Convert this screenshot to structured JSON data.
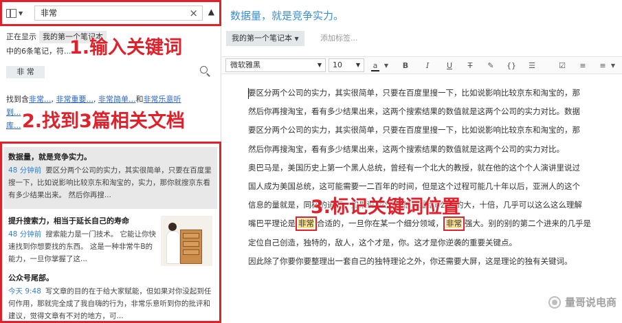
{
  "search": {
    "query": "非常",
    "clear_icon": "×",
    "collapse_icon": "▲"
  },
  "scope": {
    "prefix": "正在显示",
    "notebook": "我的第一个笔记本",
    "count_text": "中的6条笔记，符..."
  },
  "keyword_chip": "非 常",
  "found": {
    "prefix": "找到含",
    "links": [
      "非常...",
      "非常重要...",
      "非常简单...",
      "非常乐意听",
      "到...",
      "库..."
    ],
    "joiners": [
      ", ",
      ", ",
      "和"
    ]
  },
  "annotations": {
    "step1": "1.输入关键词",
    "step2": "2.找到3篇相关文档",
    "step3": "3.标记关键词位置"
  },
  "results": [
    {
      "title": "数据量，就是竞争实力。",
      "time": "48 分钟前",
      "snippet": "要区分两个公司的实力，其实很简单，只要在百度里搜一下，比如说影响比较京东和淘宝的，实力，那你就搜京东看有多少结果出来。 然后你再搜..."
    },
    {
      "title": "提升搜索力，相当于延长自己的寿命",
      "time": "48 分钟前",
      "snippet": "搜索能力是一门技术。 它能让你快速找到你想要找的东西。 这是一种非常牛B的能力，一旦你掌握了这..."
    },
    {
      "title": "公众号尾部。",
      "time": "今天 9:48",
      "snippet": "写文章的目的在于给大家赋能，但如果对你没起到任何作用，那就完全成了我自嗨的行为，非常乐意听到你的批评和建议，觉得文章有不对的地方，可..."
    }
  ],
  "note": {
    "title": "数据量，就是竞争实力。",
    "notebook_button": "我的第一个笔记本",
    "add_tag_placeholder": "添加标签...",
    "font": "微软雅黑",
    "size": "10",
    "paragraphs": [
      "要区分两个公司的实力，其实很简单，只要在百度里搜一下，比如说影响比较京东和淘宝的，那",
      "然后你再搜淘宝，看有多少结果出来，这两个搜索结果的数值就是这两个公司的实力对比。数据",
      "要区分两个公司的实力，其实很简单，只要在百度里搜一下，比如说影响比较京东和淘宝的，那",
      "然后你再搜淘宝，看有多少结果出来，这两个搜索结果的数值就是这两个公司的实力对比。",
      "奥巴马是，美国历史上第一个黑人总统，曾经有一个北大的教授，就在他的这个个人演讲里说过",
      "国人成为美国总统，这可能需要一二百年的时间，但是这个过程可能几十年以后，亚洲人的这个",
      "信息的量就是，同样的道理，如果说a公司的信息量给b公司的大，十倍，几乎可以这么这么理解",
      "",
      "定位自己创造，独特的，敌人，这个才是，你。这才是你逆袭的重要关键点。",
      "因此除了你要你要整理出一套自己的独特理论之外，你还需要大屏，这是理论的独有关键词。"
    ],
    "highlight_line": {
      "before": "嘴巴平理论是",
      "hl1": "非常",
      "middle": "合适的，一旦你在某一个细分领域，",
      "hl2": "非常",
      "after": "强大。别的别的第二个进来的几乎是"
    }
  },
  "watermark": "量哥说电商"
}
